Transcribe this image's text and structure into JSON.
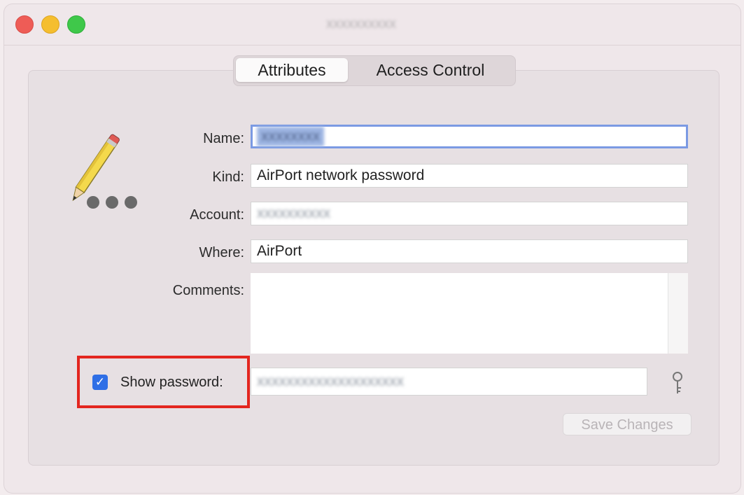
{
  "window": {
    "title": "xxxxxxxxxx",
    "controls": [
      "close",
      "minimize",
      "zoom"
    ]
  },
  "tabs": [
    {
      "label": "Attributes",
      "active": true
    },
    {
      "label": "Access Control",
      "active": false
    }
  ],
  "form": {
    "name_label": "Name:",
    "name_value": "xxxxxxxx",
    "kind_label": "Kind:",
    "kind_value": "AirPort network password",
    "account_label": "Account:",
    "account_value": "xxxxxxxxxx",
    "where_label": "Where:",
    "where_value": "AirPort",
    "comments_label": "Comments:",
    "comments_value": "",
    "show_password_label": "Show password:",
    "show_password_checked": true,
    "password_value": "xxxxxxxxxxxxxxxxxxxx",
    "save_button": "Save Changes"
  },
  "icons": {
    "item_icon": "pencil-with-dots-icon",
    "key": "key-icon"
  },
  "colors": {
    "highlight": "#e3261f",
    "focus_ring": "#7b9ae3",
    "checkbox": "#2f6fe6"
  }
}
